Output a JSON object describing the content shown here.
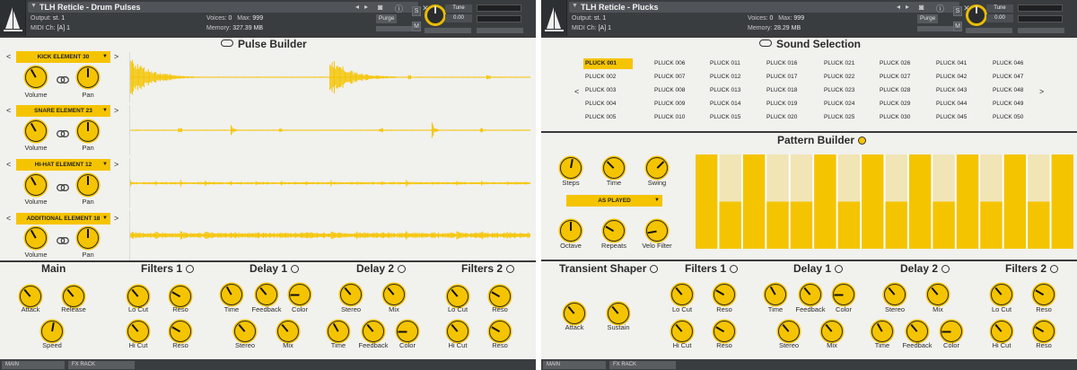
{
  "left_instrument": {
    "header": {
      "title": "TLH Reticle - Drum Pulses",
      "output_label": "Output:",
      "output_value": "st. 1",
      "midi_label": "MIDI Ch:",
      "midi_value": "[A] 1",
      "voices_label": "Voices:",
      "voices_value": "0",
      "max_label": "Max:",
      "max_value": "999",
      "memory_label": "Memory:",
      "memory_value": "327.39 MB",
      "purge_label": "Purge",
      "tune_label": "Tune",
      "tune_value": "0.00",
      "solo_label": "S",
      "mute_label": "M"
    },
    "pulse_builder": {
      "title": "Pulse Builder",
      "elements": [
        {
          "name": "KICK ELEMENT 30",
          "volume_label": "Volume",
          "pan_label": "Pan"
        },
        {
          "name": "SNARE ELEMENT 23",
          "volume_label": "Volume",
          "pan_label": "Pan"
        },
        {
          "name": "HI-HAT ELEMENT 12",
          "volume_label": "Volume",
          "pan_label": "Pan"
        },
        {
          "name": "ADDITIONAL ELEMENT 18",
          "volume_label": "Volume",
          "pan_label": "Pan"
        }
      ]
    },
    "fx": {
      "main": {
        "title": "Main",
        "attack": "Attack",
        "release": "Release",
        "speed": "Speed"
      },
      "filters1": {
        "title": "Filters 1",
        "locut": "Lo Cut",
        "reso1": "Reso",
        "hicut": "Hi Cut",
        "reso2": "Reso"
      },
      "delay1": {
        "title": "Delay 1",
        "time": "Time",
        "feedback": "Feedback",
        "color": "Color",
        "stereo": "Stereo",
        "mix": "Mix"
      },
      "delay2": {
        "title": "Delay 2",
        "stereo": "Stereo",
        "mix": "Mix",
        "time": "Time",
        "feedback": "Feedback",
        "color": "Color"
      },
      "filters2": {
        "title": "Filters 2",
        "locut": "Lo Cut",
        "reso1": "Reso",
        "hicut": "Hi Cut",
        "reso2": "Reso"
      }
    },
    "footer": {
      "tab1": "MAIN",
      "tab2": "FX RACK"
    }
  },
  "right_instrument": {
    "header": {
      "title": "TLH Reticle - Plucks",
      "output_label": "Output:",
      "output_value": "st. 1",
      "midi_label": "MIDI Ch:",
      "midi_value": "[A] 1",
      "voices_label": "Voices:",
      "voices_value": "0",
      "max_label": "Max:",
      "max_value": "999",
      "memory_label": "Memory:",
      "memory_value": "28.29 MB",
      "purge_label": "Purge",
      "tune_label": "Tune",
      "tune_value": "0.00",
      "solo_label": "S",
      "mute_label": "M"
    },
    "sound_selection": {
      "title": "Sound Selection",
      "selected": "PLUCK 001",
      "columns": [
        [
          "PLUCK 001",
          "PLUCK 002",
          "PLUCK 003",
          "PLUCK 004",
          "PLUCK 005"
        ],
        [
          "PLUCK 006",
          "PLUCK 007",
          "PLUCK 008",
          "PLUCK 009",
          "PLUCK 010"
        ],
        [
          "PLUCK 011",
          "PLUCK 012",
          "PLUCK 013",
          "PLUCK 014",
          "PLUCK 015"
        ],
        [
          "PLUCK 016",
          "PLUCK 017",
          "PLUCK 018",
          "PLUCK 019",
          "PLUCK 020"
        ],
        [
          "PLUCK 021",
          "PLUCK 022",
          "PLUCK 023",
          "PLUCK 024",
          "PLUCK 025"
        ],
        [
          "PLUCK 026",
          "PLUCK 027",
          "PLUCK 028",
          "PLUCK 029",
          "PLUCK 030"
        ],
        [
          "PLUCK 041",
          "PLUCK 042",
          "PLUCK 043",
          "PLUCK 044",
          "PLUCK 045"
        ],
        [
          "PLUCK 046",
          "PLUCK 047",
          "PLUCK 048",
          "PLUCK 049",
          "PLUCK 050"
        ]
      ]
    },
    "pattern_builder": {
      "title": "Pattern Builder",
      "steps_label": "Steps",
      "time_label": "Time",
      "swing_label": "Swing",
      "mode": "AS PLAYED",
      "octave_label": "Octave",
      "repeats_label": "Repeats",
      "velo_label": "Velo Filter",
      "velocities": [
        1.0,
        0.5,
        1.0,
        0.5,
        0.5,
        1.0,
        0.5,
        1.0,
        0.5,
        1.0,
        0.5,
        1.0,
        0.5,
        1.0,
        0.5,
        1.0
      ]
    },
    "fx": {
      "transient": {
        "title": "Transient Shaper",
        "attack": "Attack",
        "sustain": "Sustain"
      },
      "filters1": {
        "title": "Filters 1",
        "locut": "Lo Cut",
        "reso1": "Reso",
        "hicut": "Hi Cut",
        "reso2": "Reso"
      },
      "delay1": {
        "title": "Delay 1",
        "time": "Time",
        "feedback": "Feedback",
        "color": "Color",
        "stereo": "Stereo",
        "mix": "Mix"
      },
      "delay2": {
        "title": "Delay 2",
        "stereo": "Stereo",
        "mix": "Mix",
        "time": "Time",
        "feedback": "Feedback",
        "color": "Color"
      },
      "filters2": {
        "title": "Filters 2",
        "locut": "Lo Cut",
        "reso1": "Reso",
        "hicut": "Hi Cut",
        "reso2": "Reso"
      }
    },
    "footer": {
      "tab1": "MAIN",
      "tab2": "FX RACK"
    }
  },
  "colors": {
    "accent": "#f5c400",
    "accent_light": "#f1e4b5",
    "panel": "#f1f1ee",
    "header": "#3a3d40"
  },
  "icons": [
    "wrench-icon",
    "sailboat-logo-icon",
    "camera-icon",
    "info-icon",
    "close-icon",
    "link-icon",
    "infinity-icon"
  ]
}
